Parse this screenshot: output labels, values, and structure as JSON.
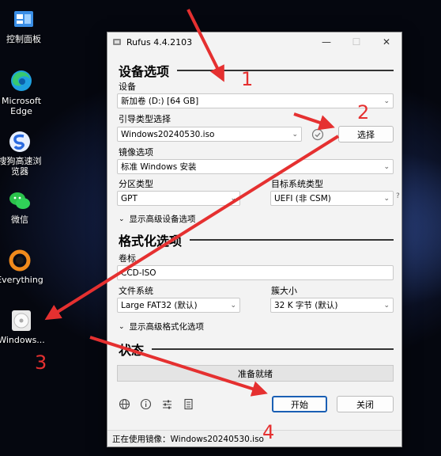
{
  "desktop": {
    "icons": [
      {
        "label": "控制面板",
        "icon": "control-panel-icon"
      },
      {
        "label": "Microsoft Edge",
        "icon": "edge-icon"
      },
      {
        "label": "搜狗高速浏览器",
        "icon": "sogou-browser-icon"
      },
      {
        "label": "微信",
        "icon": "wechat-icon"
      },
      {
        "label": "Everything",
        "icon": "everything-icon"
      },
      {
        "label": "Windows...",
        "icon": "disc-image-icon"
      }
    ]
  },
  "window": {
    "title": "Rufus 4.4.2103",
    "controls": {
      "minimize": "—",
      "maximize": "☐",
      "close": "✕"
    }
  },
  "drive_section": {
    "heading": "设备选项",
    "device_label": "设备",
    "device_value": "新加卷 (D:) [64 GB]",
    "boot_label": "引导类型选择",
    "boot_value": "Windows20240530.iso",
    "select_button": "选择",
    "image_option_label": "镜像选项",
    "image_option_value": "标准 Windows 安装",
    "partition_label": "分区类型",
    "partition_value": "GPT",
    "target_label": "目标系统类型",
    "target_value": "UEFI (非 CSM)",
    "target_help": "?",
    "advanced_toggle": "显示高级设备选项"
  },
  "format_section": {
    "heading": "格式化选项",
    "volume_label": "卷标",
    "volume_value": "CCD-ISO",
    "fs_label": "文件系统",
    "fs_value": "Large FAT32 (默认)",
    "cluster_label": "簇大小",
    "cluster_value": "32 K 字节 (默认)",
    "advanced_toggle": "显示高级格式化选项"
  },
  "status_section": {
    "heading": "状态",
    "progress_text": "准备就绪",
    "progress": 0
  },
  "footer": {
    "start_button": "开始",
    "close_button": "关闭",
    "status_text": "正在使用镜像：Windows20240530.iso"
  },
  "annotations": {
    "labels": [
      "1",
      "2",
      "3",
      "4"
    ],
    "color": "#e53030"
  }
}
